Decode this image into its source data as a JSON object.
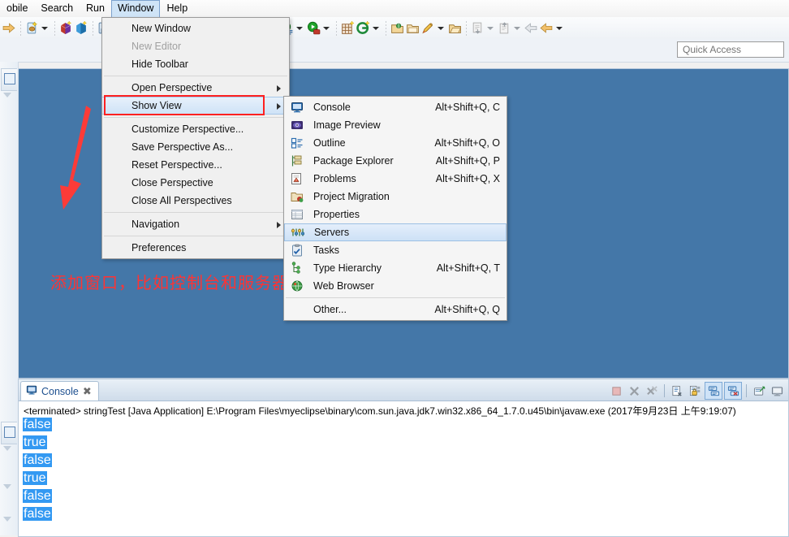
{
  "menubar": {
    "items": [
      {
        "label": "obile",
        "active": false
      },
      {
        "label": "Search",
        "active": false
      },
      {
        "label": "Run",
        "active": false
      },
      {
        "label": "Window",
        "active": true
      },
      {
        "label": "Help",
        "active": false
      }
    ]
  },
  "quick_access": {
    "placeholder": "Quick Access",
    "value": ""
  },
  "window_menu": {
    "items": [
      {
        "label": "New Window",
        "disabled": false,
        "submenu": false
      },
      {
        "label": "New Editor",
        "disabled": true,
        "submenu": false
      },
      {
        "label": "Hide Toolbar",
        "disabled": false,
        "submenu": false
      },
      {
        "separator": true
      },
      {
        "label": "Open Perspective",
        "disabled": false,
        "submenu": true
      },
      {
        "label": "Show View",
        "disabled": false,
        "submenu": true,
        "highlighted": true
      },
      {
        "separator": true
      },
      {
        "label": "Customize Perspective...",
        "disabled": false,
        "submenu": false
      },
      {
        "label": "Save Perspective As...",
        "disabled": false,
        "submenu": false
      },
      {
        "label": "Reset Perspective...",
        "disabled": false,
        "submenu": false
      },
      {
        "label": "Close Perspective",
        "disabled": false,
        "submenu": false
      },
      {
        "label": "Close All Perspectives",
        "disabled": false,
        "submenu": false
      },
      {
        "separator": true
      },
      {
        "label": "Navigation",
        "disabled": false,
        "submenu": true
      },
      {
        "separator": true
      },
      {
        "label": "Preferences",
        "disabled": false,
        "submenu": false
      }
    ]
  },
  "show_view_menu": {
    "items": [
      {
        "label": "Console",
        "accel": "Alt+Shift+Q, C",
        "icon": "console-icon",
        "selected": false
      },
      {
        "label": "Image Preview",
        "accel": "",
        "icon": "image-preview-icon",
        "selected": false
      },
      {
        "label": "Outline",
        "accel": "Alt+Shift+Q, O",
        "icon": "outline-icon",
        "selected": false
      },
      {
        "label": "Package Explorer",
        "accel": "Alt+Shift+Q, P",
        "icon": "package-explorer-icon",
        "selected": false
      },
      {
        "label": "Problems",
        "accel": "Alt+Shift+Q, X",
        "icon": "problems-icon",
        "selected": false
      },
      {
        "label": "Project Migration",
        "accel": "",
        "icon": "project-migration-icon",
        "selected": false
      },
      {
        "label": "Properties",
        "accel": "",
        "icon": "properties-icon",
        "selected": false
      },
      {
        "label": "Servers",
        "accel": "",
        "icon": "servers-icon",
        "selected": true
      },
      {
        "label": "Tasks",
        "accel": "",
        "icon": "tasks-icon",
        "selected": false
      },
      {
        "label": "Type Hierarchy",
        "accel": "Alt+Shift+Q, T",
        "icon": "type-hierarchy-icon",
        "selected": false
      },
      {
        "label": "Web Browser",
        "accel": "",
        "icon": "web-browser-icon",
        "selected": false
      },
      {
        "separator": true
      },
      {
        "label": "Other...",
        "accel": "Alt+Shift+Q, Q",
        "icon": "",
        "selected": false
      }
    ]
  },
  "annotation": {
    "text": "添加窗口，比如控制台和服务器",
    "color": "#ff3333"
  },
  "console": {
    "tab_label": "Console",
    "tab_close": "✖",
    "terminated_line": "<terminated> stringTest [Java Application] E:\\Program Files\\myeclipse\\binary\\com.sun.java.jdk7.win32.x86_64_1.7.0.u45\\bin\\javaw.exe (2017年9月23日 上午9:19:07)",
    "output_lines": [
      "false",
      "true",
      "false",
      "true",
      "false",
      "false"
    ],
    "selection_color": "#3399f2",
    "toolbar": [
      {
        "name": "terminate-icon",
        "active": false
      },
      {
        "name": "remove-launch-icon",
        "active": false
      },
      {
        "name": "remove-all-launches-icon",
        "active": false
      },
      {
        "name": "clear-console-icon",
        "active": false
      },
      {
        "name": "scroll-lock-icon",
        "active": false
      },
      {
        "name": "pin-console-icon",
        "active": true
      },
      {
        "name": "display-selected-console-icon",
        "active": true
      },
      {
        "name": "open-console-icon",
        "active": false
      },
      {
        "name": "new-console-view-icon",
        "active": false
      }
    ]
  },
  "toolbar": {
    "groups": [
      {
        "items": [
          {
            "name": "forward-arrow-icon",
            "caret": false
          }
        ]
      },
      {
        "items": [
          {
            "name": "new-wizard-icon",
            "caret": true
          }
        ]
      },
      {
        "items": [
          {
            "name": "new-project-icon",
            "caret": false
          },
          {
            "name": "new-package-icon",
            "caret": false
          }
        ]
      },
      {
        "items": [
          {
            "name": "save-icon",
            "caret": false
          },
          {
            "name": "save-all-icon",
            "caret": false
          }
        ]
      },
      {
        "items": [
          {
            "name": "report-icon",
            "caret": false
          }
        ]
      },
      {
        "items": [
          {
            "name": "web-preview-icon",
            "caret": true
          }
        ]
      },
      {
        "items": [
          {
            "name": "snapshot-icon",
            "caret": true
          }
        ]
      },
      {
        "items": [
          {
            "name": "debug-icon",
            "caret": true
          },
          {
            "name": "run-icon",
            "caret": true
          },
          {
            "name": "run-history-icon",
            "caret": true
          },
          {
            "name": "run-external-icon",
            "caret": true
          }
        ]
      },
      {
        "items": [
          {
            "name": "new-grid-icon",
            "caret": false
          },
          {
            "name": "refresh-g-icon",
            "caret": true
          }
        ]
      },
      {
        "items": [
          {
            "name": "open-type-icon",
            "caret": false
          },
          {
            "name": "open-folder-icon",
            "caret": false
          },
          {
            "name": "open-resource-icon",
            "caret": true
          },
          {
            "name": "open-task-icon",
            "caret": false
          }
        ]
      },
      {
        "items": [
          {
            "name": "checkout-icon",
            "caret": true
          },
          {
            "name": "commit-icon",
            "caret": true
          },
          {
            "name": "back-nav-icon",
            "caret": false
          },
          {
            "name": "previous-edit-icon",
            "caret": true
          }
        ]
      }
    ]
  }
}
